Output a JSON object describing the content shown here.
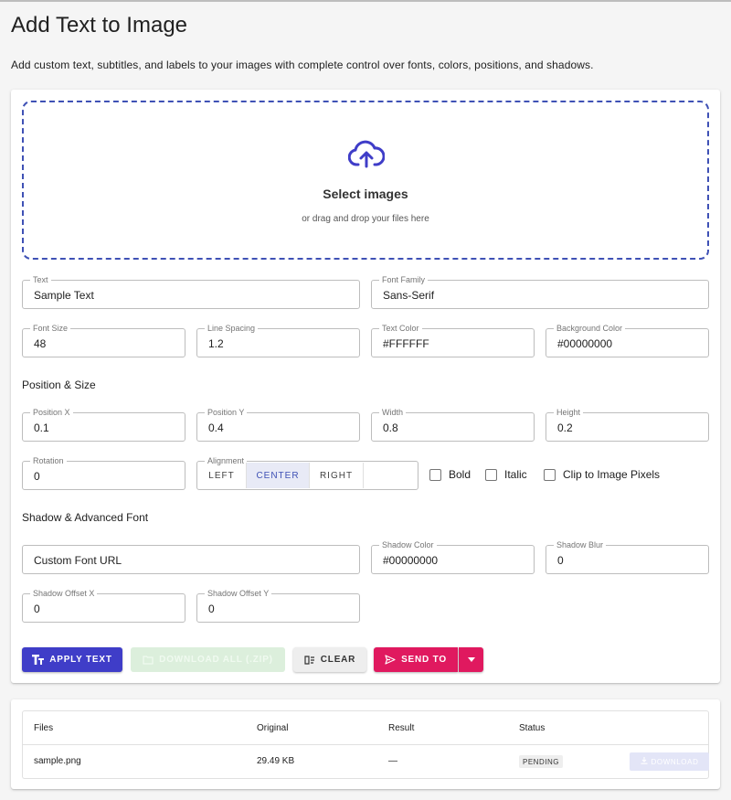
{
  "page": {
    "title": "Add Text to Image",
    "description": "Add custom text, subtitles, and labels to your images with complete control over fonts, colors, positions, and shadows."
  },
  "dropzone": {
    "title": "Select images",
    "subtitle": "or drag and drop your files here",
    "icon": "cloud-upload-icon"
  },
  "fields": {
    "text": {
      "label": "Text",
      "value": "Sample Text"
    },
    "font_family": {
      "label": "Font Family",
      "value": "Sans-Serif"
    },
    "font_size": {
      "label": "Font Size",
      "value": "48"
    },
    "line_spacing": {
      "label": "Line Spacing",
      "value": "1.2"
    },
    "text_color": {
      "label": "Text Color",
      "value": "#FFFFFF"
    },
    "background_color": {
      "label": "Background Color",
      "value": "#00000000"
    },
    "position_x": {
      "label": "Position X",
      "value": "0.1"
    },
    "position_y": {
      "label": "Position Y",
      "value": "0.4"
    },
    "width": {
      "label": "Width",
      "value": "0.8"
    },
    "height": {
      "label": "Height",
      "value": "0.2"
    },
    "rotation": {
      "label": "Rotation",
      "value": "0"
    },
    "custom_font_url": {
      "label": "",
      "value": "Custom Font URL"
    },
    "shadow_color": {
      "label": "Shadow Color",
      "value": "#00000000"
    },
    "shadow_blur": {
      "label": "Shadow Blur",
      "value": "0"
    },
    "shadow_offset_x": {
      "label": "Shadow Offset X",
      "value": "0"
    },
    "shadow_offset_y": {
      "label": "Shadow Offset Y",
      "value": "0"
    }
  },
  "sections": {
    "position_size": "Position & Size",
    "shadow_advanced": "Shadow & Advanced Font"
  },
  "alignment": {
    "label": "Alignment",
    "options": [
      "LEFT",
      "CENTER",
      "RIGHT"
    ],
    "selected": "CENTER"
  },
  "checkboxes": {
    "bold": {
      "label": "Bold",
      "checked": false
    },
    "italic": {
      "label": "Italic",
      "checked": false
    },
    "clip": {
      "label": "Clip to Image Pixels",
      "checked": false
    }
  },
  "actions": {
    "apply": "APPLY TEXT",
    "download_all": "DOWNLOAD ALL (.ZIP)",
    "clear": "CLEAR",
    "send_to": "SEND TO"
  },
  "files_table": {
    "headers": [
      "Files",
      "Original",
      "Result",
      "Status"
    ],
    "rows": [
      {
        "name": "sample.png",
        "original": "29.49 KB",
        "result": "—",
        "status": "PENDING",
        "action": "DOWNLOAD"
      }
    ]
  },
  "colors": {
    "primary": "#3f3dc8",
    "accent": "#e0195f",
    "dropzone_border": "#3f51b5"
  }
}
